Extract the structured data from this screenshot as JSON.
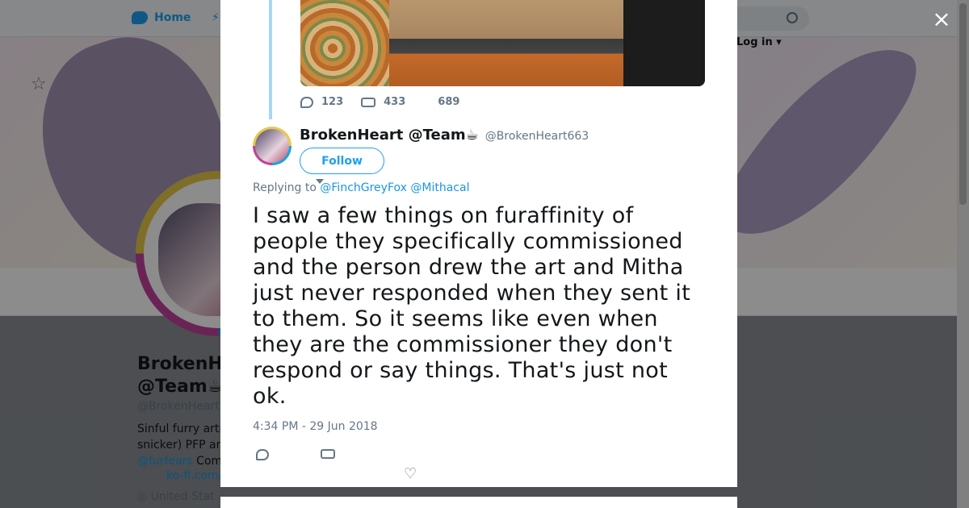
{
  "background": {
    "nav_home": "Home",
    "login": "Log in",
    "profile_name_line1": "BrokenHe",
    "profile_name_line2": "@Team",
    "profile_handle": "@BrokenHeart",
    "bio_line1": "Sinful furry arti",
    "bio_line2": "snicker) PFP an",
    "bio_mention": "@furfears",
    "bio_after_mention": " Com",
    "bio_link": "ko-fi.com/",
    "location": "United Stat"
  },
  "modal": {
    "close_label": "×",
    "parent_stats": {
      "replies": "123",
      "retweets": "433",
      "likes": "689"
    },
    "tweet": {
      "author_name": "BrokenHeart @Team☕",
      "author_handle": "@BrokenHeart663",
      "follow_label": "Follow",
      "replying_prefix": "Replying to ",
      "replying_to_1": "@FinchGreyFox",
      "replying_to_2": "@Mithacal",
      "text": "I saw a few things on furaffinity of people they specifically commissioned and the person drew the art and Mitha just never responded when they sent it to them. So it seems like even when they are the commissioner they don't respond or say things. That's just not ok.",
      "timestamp": "4:34 PM - 29 Jun 2018"
    }
  },
  "colors": {
    "accent": "#1da1f2",
    "link": "#1b95e0",
    "muted": "#657786",
    "thread_line": "#a8d6f5"
  }
}
